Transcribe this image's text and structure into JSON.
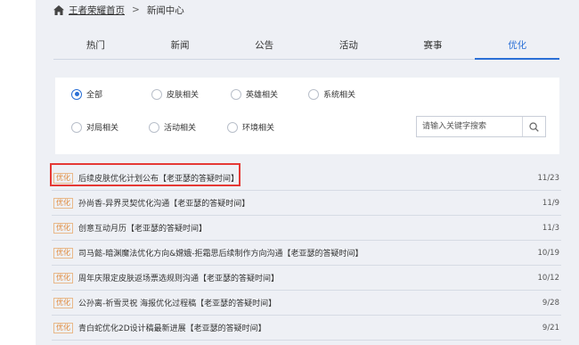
{
  "breadcrumb": {
    "home_icon": "home-icon",
    "home": "王者荣耀首页",
    "separator": ">",
    "current": "新闻中心"
  },
  "tabs": [
    {
      "label": "热门",
      "active": false
    },
    {
      "label": "新闻",
      "active": false
    },
    {
      "label": "公告",
      "active": false
    },
    {
      "label": "活动",
      "active": false
    },
    {
      "label": "赛事",
      "active": false
    },
    {
      "label": "优化",
      "active": true
    }
  ],
  "filters": {
    "row1": [
      {
        "label": "全部",
        "checked": true
      },
      {
        "label": "皮肤相关",
        "checked": false
      },
      {
        "label": "英雄相关",
        "checked": false
      },
      {
        "label": "系统相关",
        "checked": false
      }
    ],
    "row2": [
      {
        "label": "对局相关",
        "checked": false
      },
      {
        "label": "活动相关",
        "checked": false
      },
      {
        "label": "环境相关",
        "checked": false
      }
    ],
    "search": {
      "placeholder": "请输入关键字搜索",
      "icon": "search-icon"
    }
  },
  "news": [
    {
      "tag": "优化",
      "title": "后续皮肤优化计划公布【老亚瑟的答疑时间】",
      "date": "11/23"
    },
    {
      "tag": "优化",
      "title": "孙尚香-异界灵契优化沟通【老亚瑟的答疑时间】",
      "date": "11/9"
    },
    {
      "tag": "优化",
      "title": "创意互动月历【老亚瑟的答疑时间】",
      "date": "11/3"
    },
    {
      "tag": "优化",
      "title": "司马懿-暗渊魔法优化方向&嫦娥-拒霜思后续制作方向沟通【老亚瑟的答疑时间】",
      "date": "10/19"
    },
    {
      "tag": "优化",
      "title": "周年庆限定皮肤返场票选规则沟通【老亚瑟的答疑时间】",
      "date": "10/12"
    },
    {
      "tag": "优化",
      "title": "公孙离-祈雪灵祝 海报优化过程稿【老亚瑟的答疑时间】",
      "date": "9/28"
    },
    {
      "tag": "优化",
      "title": "青白蛇优化2D设计稿最新进展【老亚瑟的答疑时间】",
      "date": "9/21"
    }
  ],
  "colors": {
    "accent": "#2a6fd6",
    "tag": "#e08a3c",
    "highlight": "#e53935",
    "panel": "#eef0f5"
  }
}
